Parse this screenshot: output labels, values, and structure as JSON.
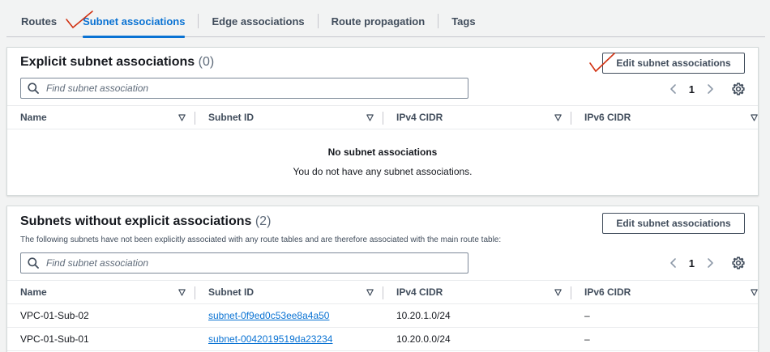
{
  "tabs": [
    {
      "label": "Routes",
      "active": false
    },
    {
      "label": "Subnet associations",
      "active": true
    },
    {
      "label": "Edge associations",
      "active": false
    },
    {
      "label": "Route propagation",
      "active": false
    },
    {
      "label": "Tags",
      "active": false
    }
  ],
  "explicit": {
    "title": "Explicit subnet associations",
    "count": "(0)",
    "edit_label": "Edit subnet associations",
    "search_placeholder": "Find subnet association",
    "page": "1",
    "columns": [
      "Name",
      "Subnet ID",
      "IPv4 CIDR",
      "IPv6 CIDR"
    ],
    "empty_title": "No subnet associations",
    "empty_text": "You do not have any subnet associations."
  },
  "implicit": {
    "title": "Subnets without explicit associations",
    "count": "(2)",
    "description": "The following subnets have not been explicitly associated with any route tables and are therefore associated with the main route table:",
    "edit_label": "Edit subnet associations",
    "search_placeholder": "Find subnet association",
    "page": "1",
    "columns": [
      "Name",
      "Subnet ID",
      "IPv4 CIDR",
      "IPv6 CIDR"
    ],
    "rows": [
      {
        "name": "VPC-01-Sub-02",
        "subnet_id": "subnet-0f9ed0c53ee8a4a50",
        "ipv4": "10.20.1.0/24",
        "ipv6": "–"
      },
      {
        "name": "VPC-01-Sub-01",
        "subnet_id": "subnet-0042019519da23234",
        "ipv4": "10.20.0.0/24",
        "ipv6": "–"
      }
    ]
  },
  "icons": {
    "search": "search-icon",
    "prev": "chevron-left-icon",
    "next": "chevron-right-icon",
    "settings": "gear-icon",
    "sort": "caret-down-icon",
    "annotation": "checkmark-icon"
  },
  "colors": {
    "accent": "#0972d3",
    "annotation": "#d13212"
  }
}
